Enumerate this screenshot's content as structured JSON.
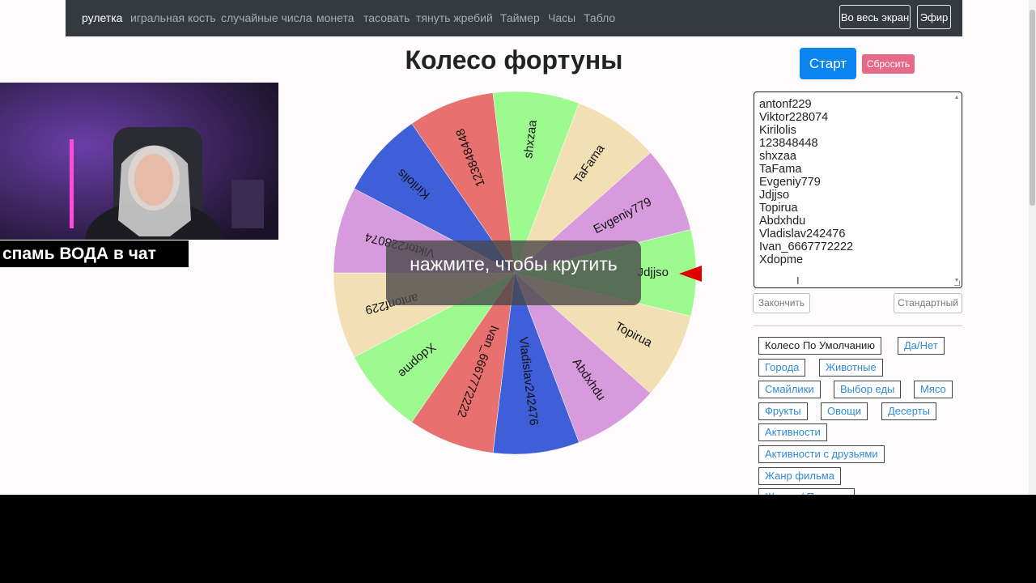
{
  "nav": {
    "items": [
      "рулетка",
      "игральная кость",
      "случайные числа",
      "монета",
      "тасовать",
      "тянуть жребий",
      "Таймер",
      "Часы",
      "Табло"
    ],
    "fullscreen_label": "Во весь экран",
    "broadcast_label": "Эфир"
  },
  "page_title": "Колесо фортуны",
  "controls": {
    "start_label": "Старт",
    "reset_label": "Сбросить"
  },
  "names": [
    "antonf229",
    "Viktor228074",
    "Kirilolis",
    "123848448",
    "shxzaa",
    "TaFama",
    "Evgeniy779",
    "Jdjjso",
    "Topirua",
    "Abdxhdu",
    "Vladislav242476",
    "Ivan_6667772222",
    "Xdopme"
  ],
  "list_buttons": {
    "finish_label": "Закончить",
    "standard_label": "Стандартный"
  },
  "presets": [
    "Колесо По Умолчанию",
    "Да/Нет",
    "Города",
    "Животные",
    "Смайлики",
    "Выбор еды",
    "Мясо",
    "Фрукты",
    "Овощи",
    "Десерты",
    "Активности",
    "Активности с друзьями",
    "Жанр фильма",
    "Шляпа / Подарок"
  ],
  "wheel": {
    "spin_prompt": "нажмите, чтобы крутить",
    "segments": [
      "Jdjjso",
      "Topirua",
      "Abdxhdu",
      "Vladislav242476",
      "Ivan_6667772222",
      "Xdopme",
      "antonf229",
      "Viktor228074",
      "Kirilolis",
      "123848448",
      "shxzaa",
      "TaFama",
      "Evgeniy779"
    ],
    "colors": [
      "#9cfa8f",
      "#f2dfb4",
      "#d79adc",
      "#3f5fd9",
      "#e8706f"
    ],
    "pointer_color": "#e00000"
  },
  "overlay": {
    "chat_caption": "спамь ВОДА в чат"
  }
}
